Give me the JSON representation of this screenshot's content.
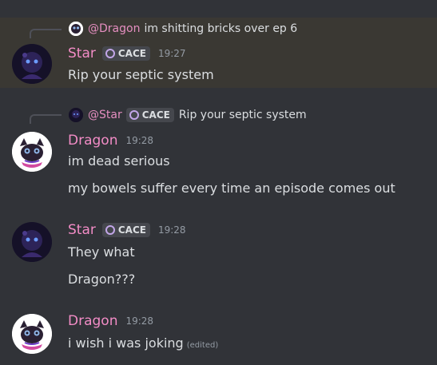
{
  "messages": [
    {
      "reply": {
        "mention": "@Dragon",
        "text": "im shitting bricks over ep 6"
      },
      "username": "Star",
      "tag": "CACE",
      "time": "19:27",
      "lines": [
        "Rip your septic system"
      ]
    },
    {
      "reply": {
        "mention": "@Star",
        "tag": "CACE",
        "text": "Rip your septic system"
      },
      "username": "Dragon",
      "time": "19:28",
      "lines": [
        "im dead serious",
        "my bowels suffer every time an episode comes out"
      ]
    },
    {
      "username": "Star",
      "tag": "CACE",
      "time": "19:28",
      "lines": [
        "They what",
        "Dragon???"
      ]
    },
    {
      "username": "Dragon",
      "time": "19:28",
      "lines": [
        "i wish i was joking"
      ],
      "edited": "(edited)"
    }
  ],
  "colors": {
    "background": "#313338",
    "highlight": "#3a3833",
    "username": "#f28cc6",
    "mention": "#e58ec0",
    "timestamp": "#949ba4"
  },
  "icons": {
    "star_avatar": "star-avatar",
    "dragon_avatar": "dragon-avatar",
    "tag_icon": "guild-tag-icon"
  }
}
